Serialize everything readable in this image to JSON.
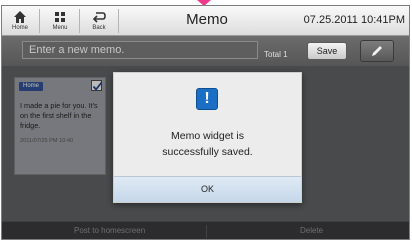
{
  "topbar": {
    "home_label": "Home",
    "menu_label": "Menu",
    "back_label": "Back",
    "title": "Memo",
    "datetime": "07.25.2011 10:41PM"
  },
  "input_bar": {
    "placeholder": "Enter a new memo.",
    "total": "Total 1",
    "save_label": "Save",
    "pen_icon": "pen-icon"
  },
  "memo_card": {
    "tag": "Home",
    "text": "I made a pie for you. It's on the first shelf in the fridge.",
    "date": "2011/07/25 PM 10:40",
    "checked": true
  },
  "dialog": {
    "icon": "exclamation-icon",
    "message_line1": "Memo widget is",
    "message_line2": "successfully saved.",
    "ok_label": "OK"
  },
  "bottom_bar": {
    "post_label": "Post to homescreen",
    "delete_label": "Delete"
  },
  "colors": {
    "accent": "#ee3a8c",
    "dialog_icon": "#1a6fc4",
    "tag_bg": "#2b4b8f"
  }
}
